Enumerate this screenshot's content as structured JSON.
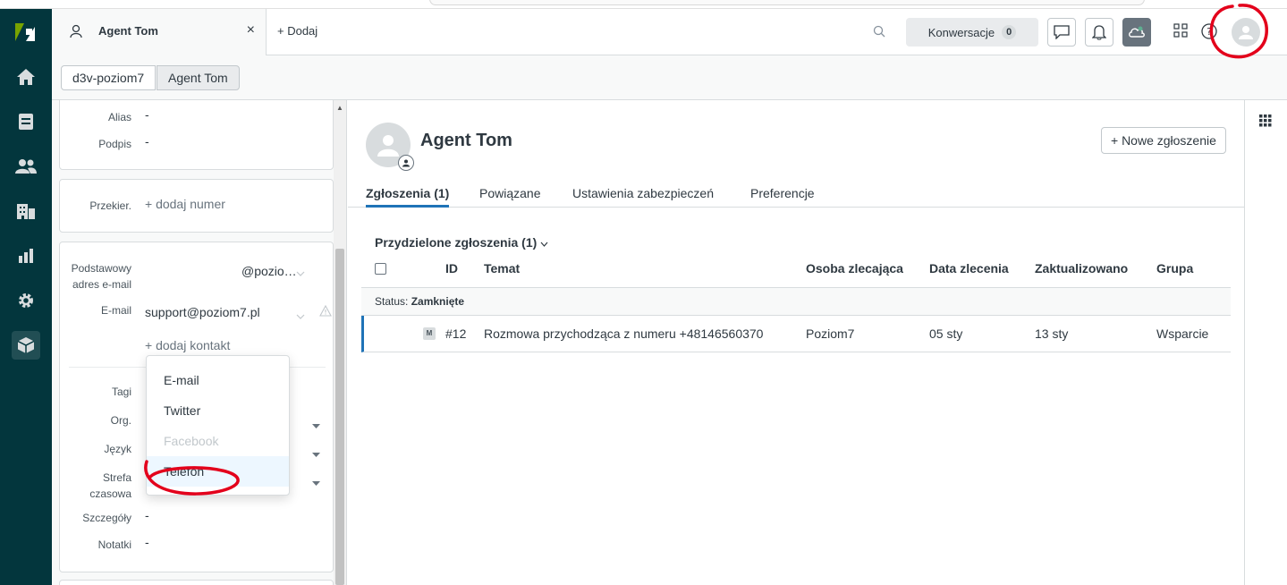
{
  "header": {
    "tab_label": "Agent Tom",
    "tab_close": "×",
    "add_label": "+ Dodaj",
    "conversations_label": "Konwersacje",
    "conversations_count": "0"
  },
  "breadcrumbs": [
    "d3v-poziom7",
    "Agent Tom"
  ],
  "left_panel": {
    "alias_label": "Alias",
    "alias_value": "-",
    "signature_label": "Podpis",
    "signature_value": "-",
    "forward_label": "Przekier.",
    "forward_value": "+ dodaj numer",
    "primary_email_label_1": "Podstawowy",
    "primary_email_label_2": "adres e-mail",
    "primary_email_value": "@pozio…",
    "email_label": "E-mail",
    "email_value": "support@poziom7.pl",
    "add_contact": "+ dodaj kontakt",
    "tags_label": "Tagi",
    "org_label": "Org.",
    "language_label": "Język",
    "timezone_label_1": "Strefa",
    "timezone_label_2": "czasowa",
    "details_label": "Szczegóły",
    "details_value": "-",
    "notes_label": "Notatki",
    "notes_value": "-"
  },
  "contact_dropdown": {
    "items": [
      {
        "label": "E-mail",
        "disabled": false
      },
      {
        "label": "Twitter",
        "disabled": false
      },
      {
        "label": "Facebook",
        "disabled": true
      },
      {
        "label": "Telefon",
        "disabled": false
      }
    ]
  },
  "user": {
    "name": "Agent Tom",
    "new_ticket_button": "+ Nowe zgłoszenie"
  },
  "tabs": [
    {
      "label": "Zgłoszenia (1)",
      "active": true
    },
    {
      "label": "Powiązane",
      "active": false
    },
    {
      "label": "Ustawienia zabezpieczeń",
      "active": false
    },
    {
      "label": "Preferencje",
      "active": false
    }
  ],
  "tickets": {
    "section_title": "Przydzielone zgłoszenia (1)",
    "columns": [
      "ID",
      "Temat",
      "Osoba zlecająca",
      "Data zlecenia",
      "Zaktualizowano",
      "Grupa"
    ],
    "status_prefix": "Status:",
    "status_value": "Zamknięte",
    "rows": [
      {
        "badge": "M",
        "id": "#12",
        "subject": "Rozmowa przychodząca z numeru +48146560370",
        "requester": "Poziom7",
        "requested": "05 sty",
        "updated": "13 sty",
        "group": "Wsparcie"
      }
    ]
  },
  "colors": {
    "nav_bg": "#03363d",
    "accent": "#1f73b7",
    "annotation": "#e3001b"
  },
  "icons": [
    "home-icon",
    "tickets-icon",
    "users-icon",
    "organizations-icon",
    "reports-icon",
    "settings-icon",
    "apps-icon",
    "search-icon",
    "chat-icon",
    "bell-icon",
    "cloud-icon",
    "grid-icon",
    "help-icon",
    "person-icon"
  ]
}
